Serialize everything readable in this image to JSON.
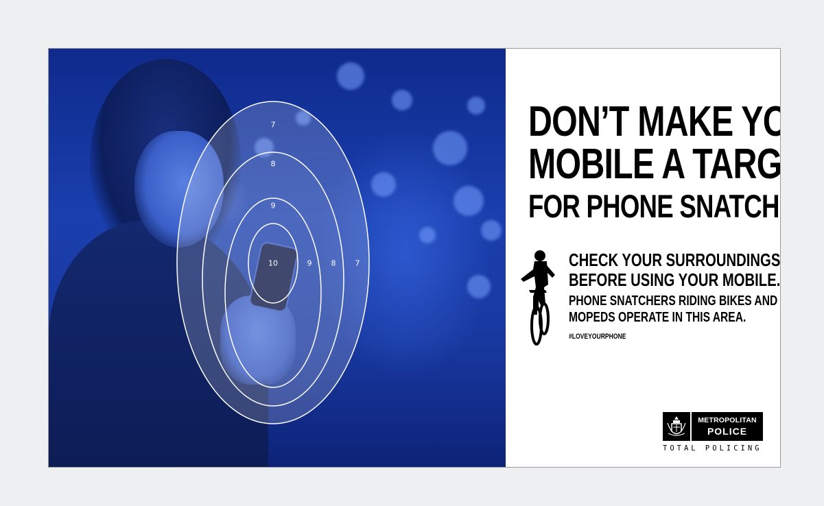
{
  "poster": {
    "headline": {
      "line1": "DON’T MAKE YOUR",
      "line2": "MOBILE A TARGET",
      "line3": "FOR PHONE SNATCHERS"
    },
    "tip_main_line1": "CHECK YOUR SURROUNDINGS",
    "tip_main_line2": "BEFORE USING YOUR MOBILE.",
    "tip_sub_line1": "PHONE SNATCHERS RIDING BIKES AND",
    "tip_sub_line2": "MOPEDS OPERATE IN THIS AREA.",
    "hashtag": "#LOVEYOURPHONE",
    "logo": {
      "line1": "METROPOLITAN",
      "line2": "POLICE",
      "tagline": "TOTAL POLICING"
    },
    "target_rings": {
      "top_labels": [
        "7",
        "8",
        "9"
      ],
      "center_label": "10",
      "side_labels": [
        "9",
        "8",
        "7"
      ]
    },
    "colors": {
      "photo_tint": "#1a3fae",
      "ink": "#000000",
      "paper": "#ffffff",
      "frame": "#eeeff1"
    },
    "icons": [
      "cyclist-silhouette-icon",
      "met-police-crest-icon"
    ]
  }
}
